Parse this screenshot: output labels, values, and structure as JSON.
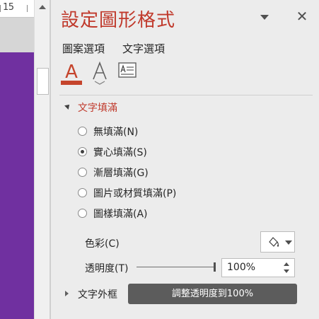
{
  "ruler": {
    "number": "15"
  },
  "slide": {
    "background_color": "#7030a0"
  },
  "pane": {
    "title": "設定圖形格式",
    "options_icon": "chevron-down-icon",
    "close_glyph": "✕",
    "tabs": [
      {
        "label": "圖案選項"
      },
      {
        "label": "文字選項"
      }
    ],
    "icon_tabs": [
      "text-fill-outline-icon",
      "text-effects-icon",
      "textbox-icon"
    ],
    "accent_color": "#c5442c"
  },
  "text_fill": {
    "title": "文字填滿",
    "options": [
      {
        "label": "無填滿(N)",
        "selected": false
      },
      {
        "label": "實心填滿(S)",
        "selected": true
      },
      {
        "label": "漸層填滿(G)",
        "selected": false
      },
      {
        "label": "圖片或材質填滿(P)",
        "selected": false
      },
      {
        "label": "圖樣填滿(A)",
        "selected": false
      }
    ],
    "color_label": "色彩(C)",
    "transparency_label": "透明度(T)",
    "transparency_value": "100%",
    "transparency_fraction": 1.0
  },
  "text_outline": {
    "title": "文字外框"
  },
  "tooltip": {
    "text": "調整透明度到100%"
  }
}
